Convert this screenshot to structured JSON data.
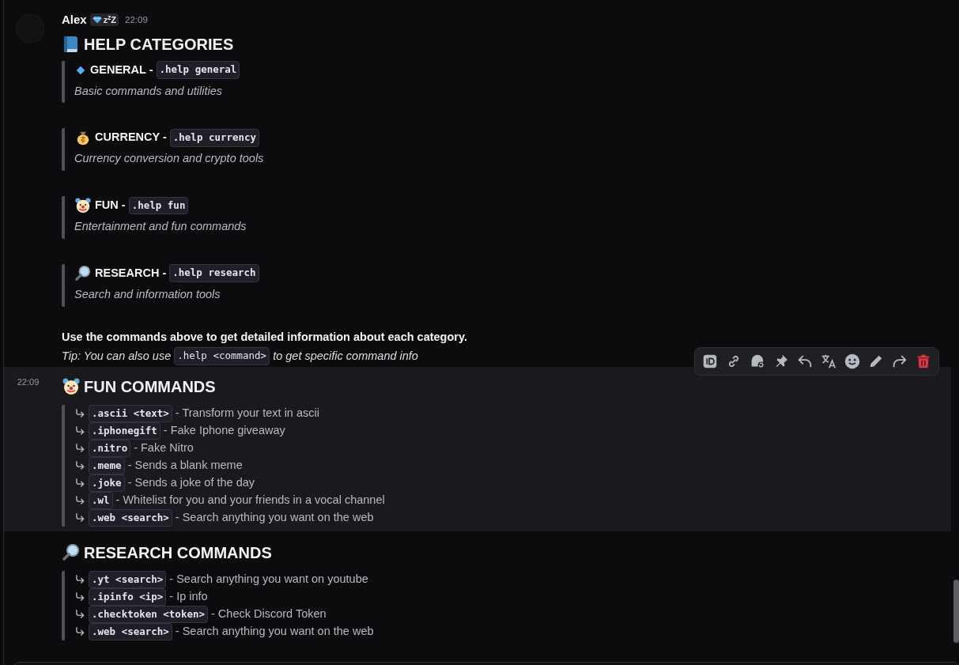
{
  "help_message": {
    "author": "Alex",
    "badge": {
      "text": "z$^{z}$Z"
    },
    "time": "22:09",
    "title": "HELP CATEGORIES",
    "categories": [
      {
        "name": "GENERAL -",
        "command": ".help general",
        "description": "Basic commands and utilities"
      },
      {
        "name": "CURRENCY -",
        "command": ".help currency",
        "description": "Currency conversion and crypto tools"
      },
      {
        "name": "FUN -",
        "command": ".help fun",
        "description": "Entertainment and fun commands"
      },
      {
        "name": "RESEARCH -",
        "command": ".help research",
        "description": "Search and information tools"
      }
    ],
    "footer": "Use the commands above to get detailed information about each category.",
    "tip": {
      "before": "Tip: You can also use",
      "command": ".help <command>",
      "after": "to get specific command info"
    }
  },
  "fun_message": {
    "time": "22:09",
    "hovered": true,
    "title": "FUN COMMANDS",
    "actions": [
      {
        "kind": "id"
      },
      {
        "kind": "link"
      },
      {
        "kind": "thread"
      },
      {
        "kind": "pin"
      },
      {
        "kind": "reply"
      },
      {
        "kind": "translate"
      },
      {
        "kind": "reaction"
      },
      {
        "kind": "edit"
      },
      {
        "kind": "forward"
      },
      {
        "kind": "delete"
      }
    ],
    "commands": [
      {
        "command": ".ascii <text>",
        "description": "- Transform your text in ascii"
      },
      {
        "command": ".iphonegift",
        "description": "- Fake Iphone giveaway"
      },
      {
        "command": ".nitro",
        "description": "- Fake Nitro"
      },
      {
        "command": ".meme",
        "description": "- Sends a blank meme"
      },
      {
        "command": ".joke",
        "description": "- Sends a joke of the day"
      },
      {
        "command": ".wl",
        "description": "- Whitelist for you and your friends in a vocal channel"
      },
      {
        "command": ".web <search>",
        "description": "- Search anything you want on the web"
      }
    ]
  },
  "research_message": {
    "title": "RESEARCH COMMANDS",
    "commands": [
      {
        "command": ".yt <search>",
        "description": "- Search anything you want on youtube"
      },
      {
        "command": ".ipinfo <ip>",
        "description": "- Ip info"
      },
      {
        "command": ".checktoken <token>",
        "description": "- Check Discord Token"
      },
      {
        "command": ".web <search>",
        "description": "- Search anything you want on the web"
      }
    ]
  }
}
